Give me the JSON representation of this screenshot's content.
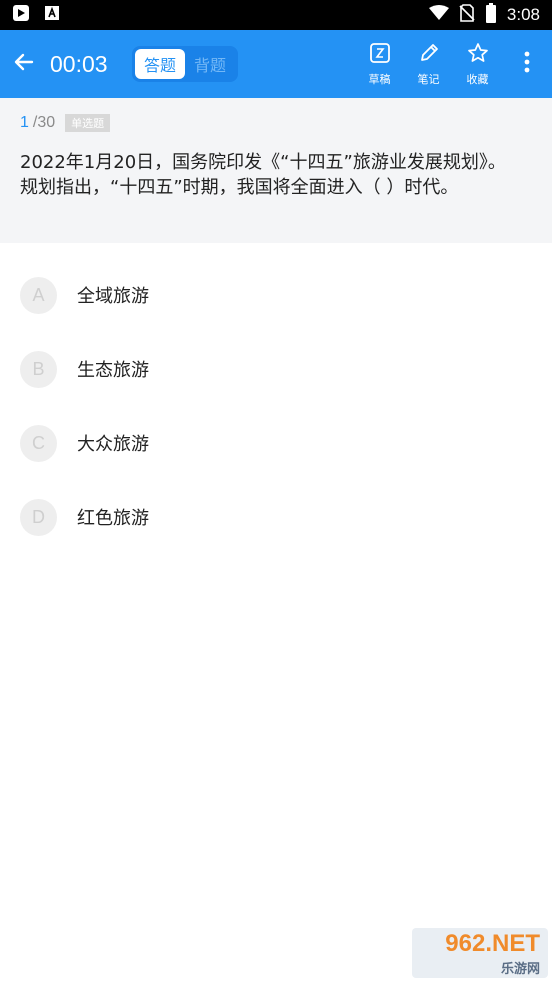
{
  "status_bar": {
    "time": "3:08",
    "left_icons": [
      "play-store-notification-icon",
      "text-app-notification-icon"
    ],
    "right_icons": [
      "wifi-icon",
      "no-sim-icon",
      "battery-icon"
    ]
  },
  "app_bar": {
    "timer": "00:03",
    "modes": [
      {
        "label": "答题",
        "active": true
      },
      {
        "label": "背题",
        "active": false
      }
    ],
    "tools": [
      {
        "label": "草稿",
        "icon": "draft-icon"
      },
      {
        "label": "笔记",
        "icon": "pencil-icon"
      },
      {
        "label": "收藏",
        "icon": "star-icon"
      }
    ],
    "more_icon": "more-vert-icon"
  },
  "question": {
    "current": "1",
    "total": "/30",
    "type": "单选题",
    "text": "2022年1月20日，国务院印发《“十四五”旅游业发展规划》。规划指出，“十四五”时期，我国将全面进入（ ）时代。"
  },
  "options": [
    {
      "key": "A",
      "text": "全域旅游"
    },
    {
      "key": "B",
      "text": "生态旅游"
    },
    {
      "key": "C",
      "text": "大众旅游"
    },
    {
      "key": "D",
      "text": "红色旅游"
    }
  ],
  "watermark": {
    "top": "962.NET",
    "bottom": "乐游网"
  },
  "colors": {
    "primary": "#2492f4",
    "status_bar": "#000000",
    "question_bg": "#f4f5f7",
    "option_circle": "#eeeeee"
  }
}
